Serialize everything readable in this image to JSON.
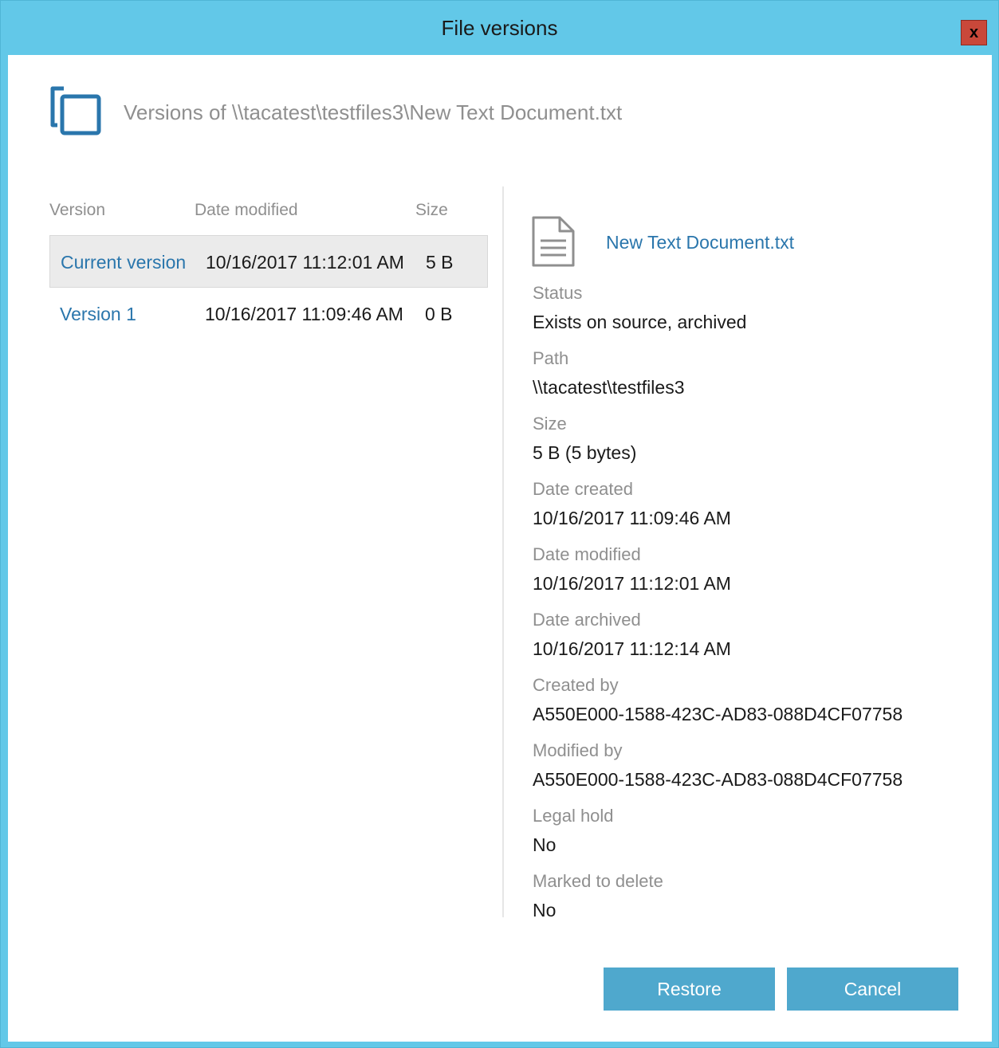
{
  "window": {
    "title": "File versions",
    "close_label": "x"
  },
  "header": {
    "title": "Versions of \\\\tacatest\\testfiles3\\New Text Document.txt",
    "icon": "copy-icon"
  },
  "versions": {
    "columns": [
      "Version",
      "Date modified",
      "Size"
    ],
    "rows": [
      {
        "name": "Current version",
        "date": "10/16/2017 11:12:01 AM",
        "size": "5 B",
        "selected": true
      },
      {
        "name": "Version 1",
        "date": "10/16/2017 11:09:46 AM",
        "size": "0 B",
        "selected": false
      }
    ]
  },
  "details": {
    "icon": "document-icon",
    "file_name": "New Text Document.txt",
    "fields": [
      {
        "label": "Status",
        "value": "Exists on source, archived"
      },
      {
        "label": "Path",
        "value": "\\\\tacatest\\testfiles3"
      },
      {
        "label": "Size",
        "value": "5 B (5 bytes)"
      },
      {
        "label": "Date created",
        "value": "10/16/2017 11:09:46 AM"
      },
      {
        "label": "Date modified",
        "value": "10/16/2017 11:12:01 AM"
      },
      {
        "label": "Date archived",
        "value": "10/16/2017 11:12:14 AM"
      },
      {
        "label": "Created by",
        "value": "A550E000-1588-423C-AD83-088D4CF07758"
      },
      {
        "label": "Modified by",
        "value": "A550E000-1588-423C-AD83-088D4CF07758"
      },
      {
        "label": "Legal hold",
        "value": "No"
      },
      {
        "label": "Marked to delete",
        "value": "No"
      }
    ]
  },
  "buttons": {
    "restore_label": "Restore",
    "cancel_label": "Cancel"
  },
  "colors": {
    "titlebar": "#62c8e8",
    "accent_text": "#2a76ac",
    "button": "#4fa8cd",
    "close": "#c9483a"
  }
}
